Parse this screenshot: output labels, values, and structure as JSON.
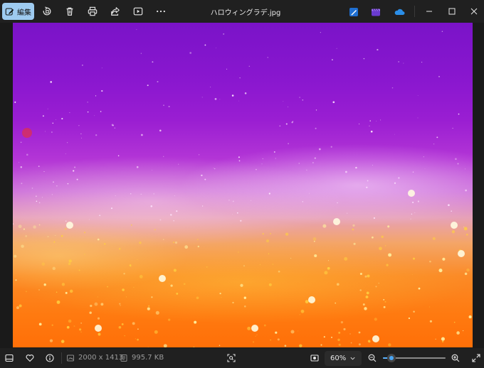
{
  "toolbar": {
    "edit_label": "編集",
    "file_name": "ハロウィングラデ.jpg",
    "icons": [
      "edit-icon",
      "rotate-icon",
      "delete-icon",
      "print-icon",
      "share-icon",
      "slideshow-icon",
      "more-icon"
    ],
    "app_icons": [
      "designer-app-icon",
      "clipchamp-app-icon",
      "onedrive-icon"
    ],
    "window_controls": [
      "minimize-icon",
      "maximize-icon",
      "close-icon"
    ]
  },
  "image": {
    "description_colors": {
      "top": "#7a13c8",
      "middle": "#c96ad8",
      "bottom": "#ff6f08"
    }
  },
  "statusbar": {
    "dimensions": "2000 x 1413",
    "file_size": "995.7 KB",
    "zoom_label": "60%",
    "zoom_level": 0.14
  },
  "colors": {
    "accent": "#9ecbf0",
    "slider_accent": "#4aa6f5",
    "background": "#202020"
  }
}
